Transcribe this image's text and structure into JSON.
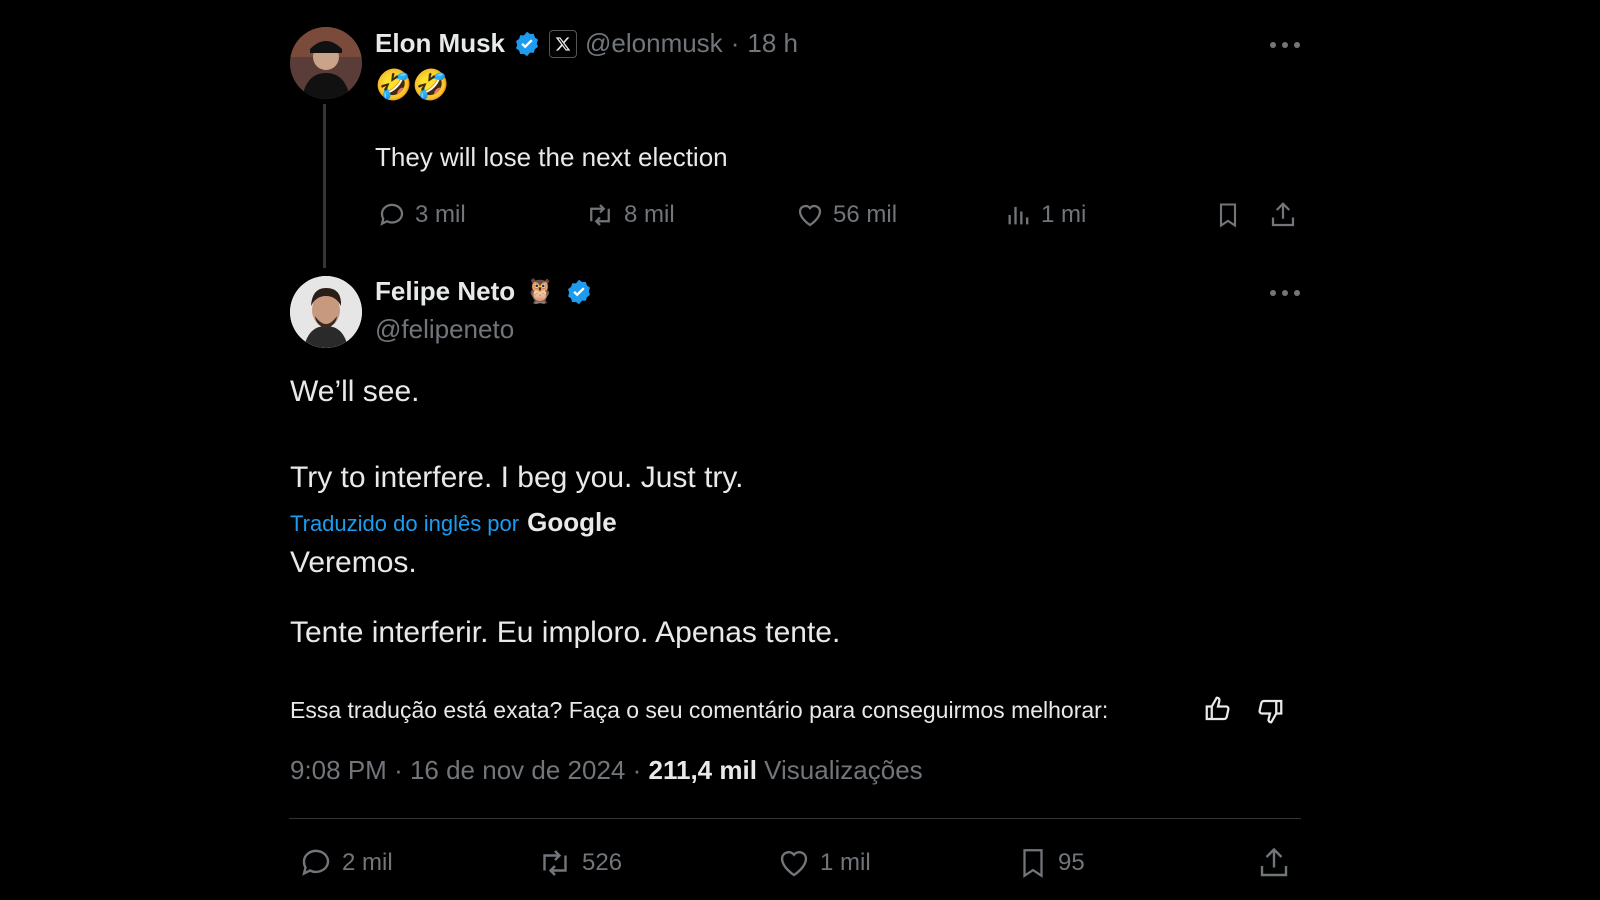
{
  "parent_tweet": {
    "author_name": "Elon Musk",
    "handle": "@elonmusk",
    "time_ago": "18 h",
    "emoji": "🤣🤣",
    "text": "They will lose the next election",
    "actions": {
      "replies": "3 mil",
      "retweets": "8 mil",
      "likes": "56 mil",
      "views": "1 mi"
    }
  },
  "reply_tweet": {
    "author_name": "Felipe Neto",
    "name_emoji": "🦉",
    "handle": "@felipeneto",
    "text_line1": "We’ll see.",
    "text_line2": "Try to interfere. I beg you. Just try.",
    "translated_by_label": "Traduzido do inglês por",
    "translator_brand": "Google",
    "translation_line1": "Veremos.",
    "translation_line2": "Tente interferir. Eu imploro. Apenas tente.",
    "feedback_prompt": "Essa tradução está exata? Faça o seu comentário para conseguirmos melhorar:",
    "timestamp": "9:08 PM",
    "date": "16 de nov de 2024",
    "views_count": "211,4 mil",
    "views_label": "Visualizações",
    "actions": {
      "replies": "2 mil",
      "retweets": "526",
      "likes": "1 mil",
      "bookmarks": "95"
    }
  },
  "colors": {
    "background": "#000000",
    "text": "#e7e9ea",
    "muted": "#71767b",
    "link": "#1d9bf0",
    "verified": "#1d9bf0"
  }
}
